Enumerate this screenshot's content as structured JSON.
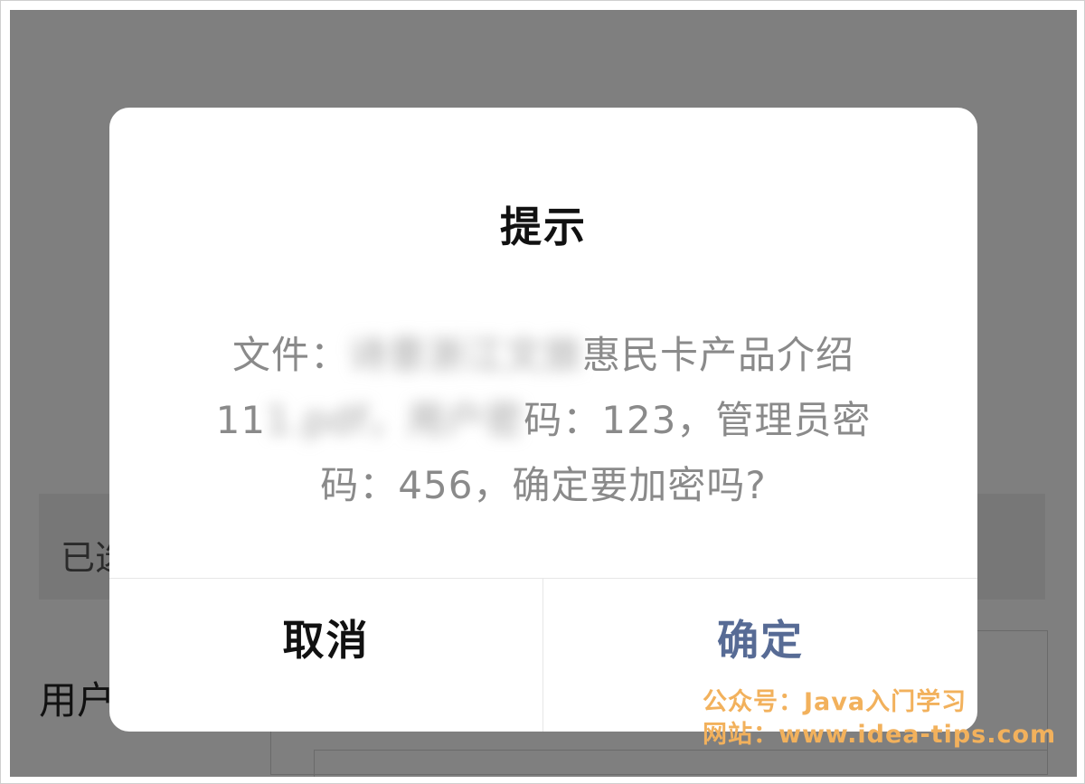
{
  "background": {
    "selected_text": "已选",
    "user_label": "用户"
  },
  "dialog": {
    "title": "提示",
    "message_parts": {
      "p1": "文件：",
      "blur1": "诗意浙江文旅",
      "p2": "惠民卡产品介绍 11",
      "blur2": "1.pdf，用户密",
      "p3": "码：123，管理员密码：456，确定要加密吗?"
    },
    "cancel_label": "取消",
    "confirm_label": "确定",
    "confirm_color": "#576b95"
  },
  "watermark": {
    "line1": "公众号：Java入门学习",
    "line2": "网站：www.idea-tips.com",
    "color": "#f2b15c"
  }
}
